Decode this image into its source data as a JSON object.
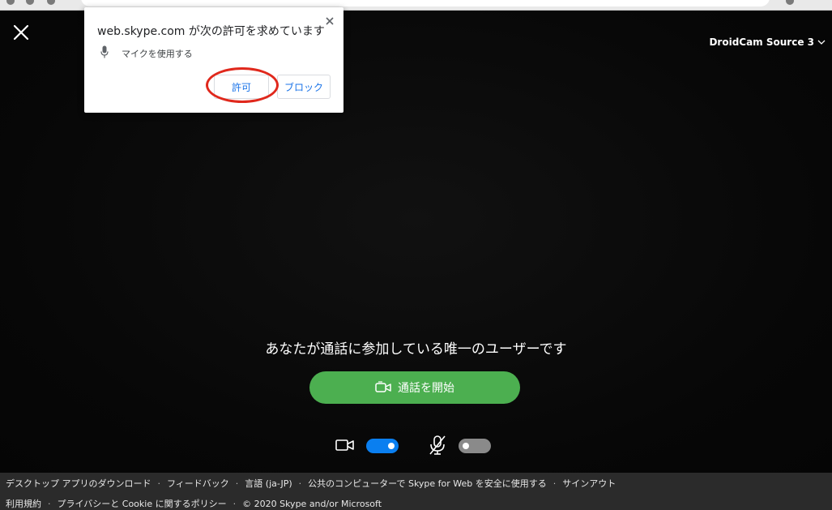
{
  "permission_popup": {
    "title": "web.skype.com が次の許可を求めています",
    "mic_desc": "マイクを使用する",
    "allow_label": "許可",
    "block_label": "ブロック"
  },
  "header": {
    "camera_source": "DroidCam Source 3"
  },
  "call": {
    "only_user_message": "あなたが通話に参加している唯一のユーザーです",
    "start_call_label": "通話を開始",
    "video_toggle_on": true,
    "mic_toggle_on": false
  },
  "footer": {
    "row1": [
      "デスクトップ アプリのダウンロード",
      "フィードバック",
      "言語 (ja-JP)",
      "公共のコンピューターで Skype for Web を安全に使用する",
      "サインアウト"
    ],
    "row2": [
      "利用規約",
      "プライバシーと Cookie に関するポリシー",
      "© 2020 Skype and/or Microsoft"
    ]
  },
  "colors": {
    "start_call_green": "#4caf50",
    "toggle_on_blue": "#0a7ff0",
    "toggle_off_gray": "#8a8a8a",
    "highlight_red": "#e0281c"
  }
}
